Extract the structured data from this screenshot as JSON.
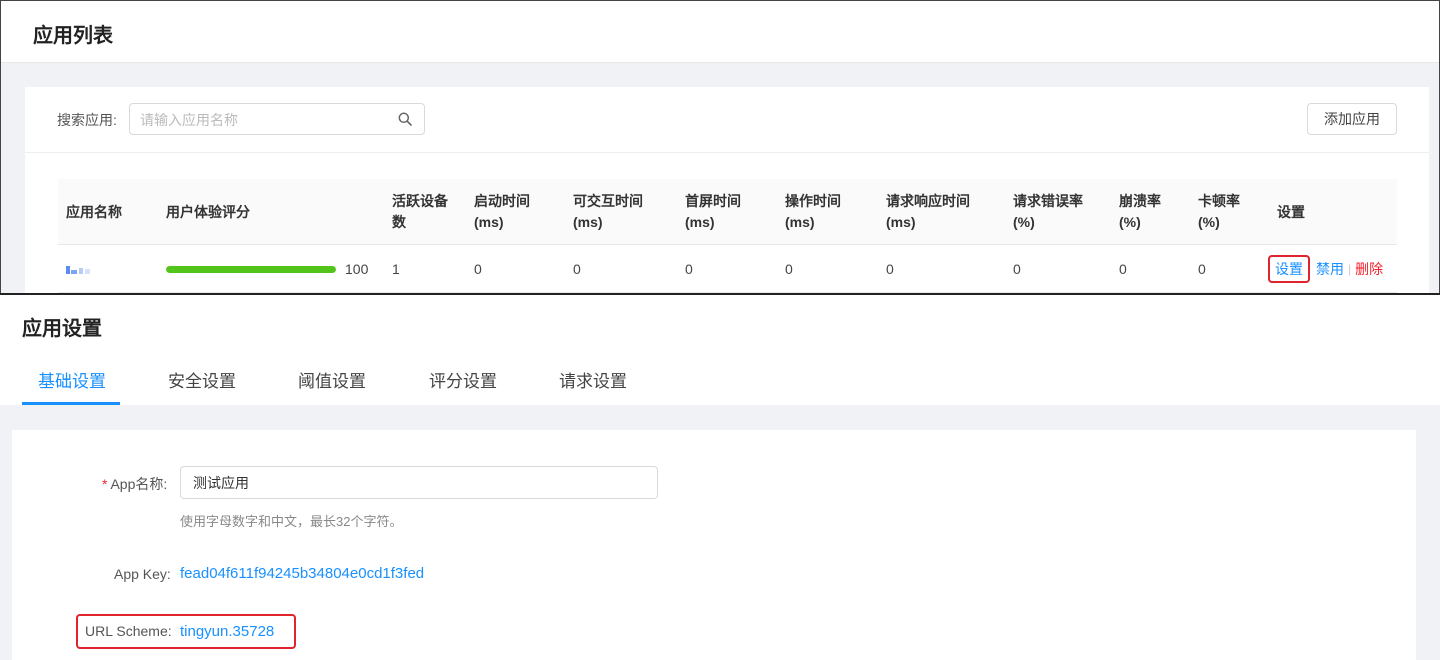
{
  "list_page": {
    "title": "应用列表",
    "search": {
      "label": "搜索应用:",
      "placeholder": "请输入应用名称"
    },
    "add_button": "添加应用",
    "table": {
      "headers": {
        "name": "应用名称",
        "score": "用户体验评分",
        "active_devices_1": "活跃设备",
        "active_devices_2": "数",
        "startup_1": "启动时间",
        "startup_2": "(ms)",
        "interactive_1": "可交互时间",
        "interactive_2": "(ms)",
        "first_screen_1": "首屏时间",
        "first_screen_2": "(ms)",
        "operation_1": "操作时间",
        "operation_2": "(ms)",
        "response_1": "请求响应时间",
        "response_2": "(ms)",
        "error_rate_1": "请求错误率",
        "error_rate_2": "(%)",
        "crash_rate_1": "崩溃率",
        "crash_rate_2": "(%)",
        "freeze_rate_1": "卡顿率",
        "freeze_rate_2": "(%)",
        "settings": "设置"
      },
      "rows": [
        {
          "score_fraction": 1.0,
          "score": "100",
          "active_devices": "1",
          "startup": "0",
          "interactive": "0",
          "first_screen": "0",
          "operation": "0",
          "response": "0",
          "error_rate": "0",
          "crash_rate": "0",
          "freeze_rate": "0",
          "actions": {
            "settings": "设置",
            "disable": "禁用",
            "delete": "删除"
          }
        }
      ]
    }
  },
  "settings_page": {
    "title": "应用设置",
    "tabs": [
      "基础设置",
      "安全设置",
      "阈值设置",
      "评分设置",
      "请求设置"
    ],
    "active_tab": "基础设置",
    "form": {
      "app_name_label": "App名称:",
      "app_name_value": "测试应用",
      "app_name_hint": "使用字母数字和中文，最长32个字符。",
      "app_key_label": "App Key:",
      "app_key_value": "fead04f611f94245b34804e0cd1f3fed",
      "url_scheme_label": "URL Scheme:",
      "url_scheme_value": "tingyun.35728"
    }
  },
  "colors": {
    "accent": "#1890ff",
    "danger": "#f5222d",
    "score_bar": "#52c41a",
    "highlight_box": "#e0242e"
  }
}
